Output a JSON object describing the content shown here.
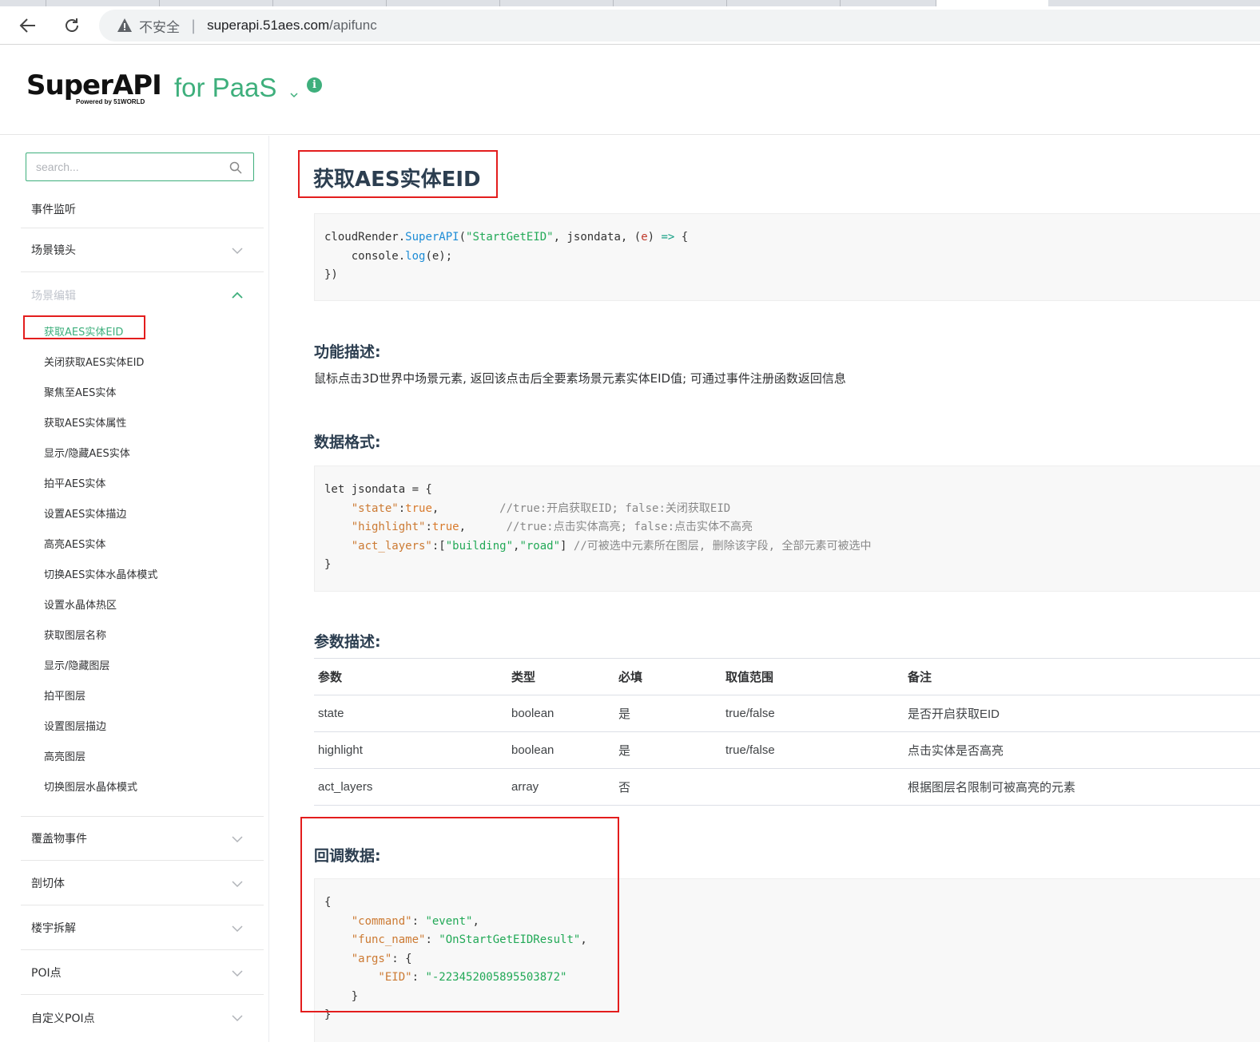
{
  "browser": {
    "insecure_label": "不安全",
    "separator": "|",
    "url_host": "superapi.51aes.com",
    "url_path": "/apifunc"
  },
  "header": {
    "logo_main": "SuperAPI",
    "logo_sub": "Powered by 51WORLD",
    "product": "for PaaS",
    "info_icon": "i"
  },
  "sidebar": {
    "search_placeholder": "search...",
    "groups": [
      {
        "label": "事件监听"
      },
      {
        "label": "场景镜头"
      },
      {
        "label": "场景编辑"
      }
    ],
    "sub_items": [
      "获取AES实体EID",
      "关闭获取AES实体EID",
      "聚焦至AES实体",
      "获取AES实体属性",
      "显示/隐藏AES实体",
      "拍平AES实体",
      "设置AES实体描边",
      "高亮AES实体",
      "切换AES实体水晶体模式",
      "设置水晶体热区",
      "获取图层名称",
      "显示/隐藏图层",
      "拍平图层",
      "设置图层描边",
      "高亮图层",
      "切换图层水晶体模式"
    ],
    "bottom_groups": [
      {
        "label": "覆盖物事件"
      },
      {
        "label": "剖切体"
      },
      {
        "label": "楼宇拆解"
      },
      {
        "label": "POI点"
      },
      {
        "label": "自定义POI点"
      }
    ]
  },
  "main": {
    "title": "获取AES实体EID",
    "code1": {
      "l1_obj": "cloudRender",
      "l1_dot": ".",
      "l1_fn": "SuperAPI",
      "l1_open": "(",
      "l1_str": "\"StartGetEID\"",
      "l1_mid": ", jsondata, ",
      "l1_p_open": "(",
      "l1_param": "e",
      "l1_p_close": ") ",
      "l1_arrow": "=>",
      "l1_brace": " {",
      "l2_obj": "    console.",
      "l2_fn": "log",
      "l2_rest": "(e);",
      "l3": "})"
    },
    "func_desc_title": "功能描述:",
    "func_desc_text": "鼠标点击3D世界中场景元素, 返回该点击后全要素场景元素实体EID值; 可通过事件注册函数返回信息",
    "data_format_title": "数据格式:",
    "code2": {
      "l1": "let jsondata = {",
      "l2_key": "    \"state\"",
      "l2_colon": ":",
      "l2_val": "true",
      "l2_comma": ",",
      "l2_cmt": "         //true:开启获取EID; false:关闭获取EID",
      "l3_key": "    \"highlight\"",
      "l3_colon": ":",
      "l3_val": "true",
      "l3_comma": ",",
      "l3_cmt": "      //true:点击实体高亮; false:点击实体不高亮",
      "l4_key": "    \"act_layers\"",
      "l4_colon": ":[",
      "l4_v1": "\"building\"",
      "l4_c": ",",
      "l4_v2": "\"road\"",
      "l4_close": "] ",
      "l4_cmt": "//可被选中元素所在图层, 删除该字段, 全部元素可被选中",
      "l5": "}"
    },
    "param_desc_title": "参数描述:",
    "table": {
      "headers": [
        "参数",
        "类型",
        "必填",
        "取值范围",
        "备注"
      ],
      "rows": [
        [
          "state",
          "boolean",
          "是",
          "true/false",
          "是否开启获取EID"
        ],
        [
          "highlight",
          "boolean",
          "是",
          "true/false",
          "点击实体是否高亮"
        ],
        [
          "act_layers",
          "array",
          "否",
          "",
          "根据图层名限制可被高亮的元素"
        ]
      ]
    },
    "callback_title": "回调数据:",
    "code3": {
      "l1": "{",
      "l2_key": "    \"command\"",
      "l2_colon": ": ",
      "l2_val": "\"event\"",
      "l2_comma": ",",
      "l3_key": "    \"func_name\"",
      "l3_colon": ": ",
      "l3_val": "\"OnStartGetEIDResult\"",
      "l3_comma": ",",
      "l4_key": "    \"args\"",
      "l4_rest": ": {",
      "l5_key": "        \"EID\"",
      "l5_colon": ": ",
      "l5_val": "\"-2234520058955038​72\"",
      "l6": "    }",
      "l7": "}"
    }
  }
}
